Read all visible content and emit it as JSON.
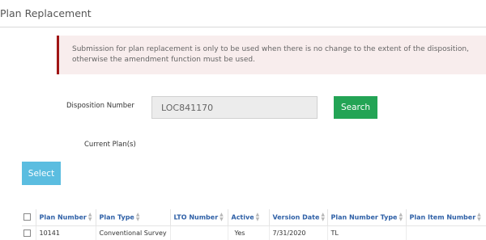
{
  "panel": {
    "title": "Plan Replacement"
  },
  "alert": {
    "message_line1": "Submission for plan replacement is only to be used when there is no change to the extent of the disposition,",
    "message_line2": "otherwise the amendment function must be used."
  },
  "form": {
    "disposition_label": "Disposition Number",
    "disposition_value": "LOC841170",
    "search_label": "Search",
    "current_plans_label": "Current Plan(s)"
  },
  "select_button": {
    "label": "Select"
  },
  "table": {
    "sort_icon": "sort-arrows-icon",
    "columns": [
      "Plan Number",
      "Plan Type",
      "LTO Number",
      "Active",
      "Version Date",
      "Plan Number Type",
      "Plan Item Number"
    ],
    "rows": [
      {
        "plan_number": "10141",
        "plan_type": "Conventional Survey",
        "lto_number": "",
        "active": "Yes",
        "version_date": "7/31/2020",
        "plan_number_type": "TL",
        "plan_item_number": ""
      }
    ]
  },
  "colors": {
    "search_button": "#23a455",
    "select_button": "#5bbde0",
    "alert_border": "#a01515",
    "alert_background": "#f8eded",
    "column_header_text": "#2d5fa6"
  }
}
